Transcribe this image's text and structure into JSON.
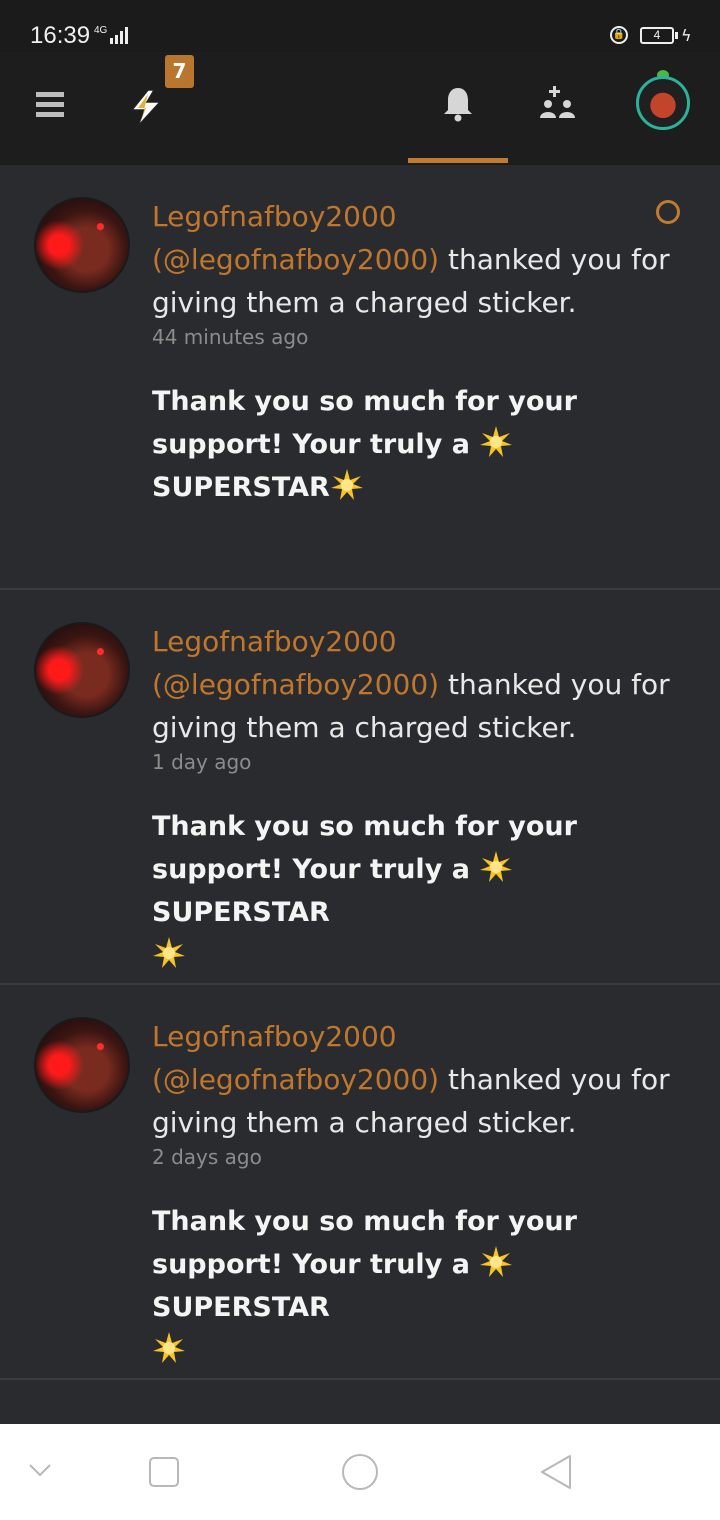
{
  "status": {
    "time": "16:39",
    "network": "4G",
    "battery": "4"
  },
  "header": {
    "badge_count": "7",
    "active_tab": "notifications"
  },
  "notifications": [
    {
      "user": "Legofnafboy2000",
      "handle": "(@legofnafboy2000)",
      "action": " thanked you for giving them a charged sticker.",
      "time": "44 minutes ago",
      "message_a": "Thank you so much for your support! Your truly a ",
      "message_b": "SUPERSTAR",
      "unread": true
    },
    {
      "user": "Legofnafboy2000",
      "handle": "(@legofnafboy2000)",
      "action": " thanked you for giving them a charged sticker.",
      "time": "1 day ago",
      "message_a": "Thank you so much for your support! Your truly a ",
      "message_b": "SUPERSTAR",
      "unread": false
    },
    {
      "user": "Legofnafboy2000",
      "handle": "(@legofnafboy2000)",
      "action": " thanked you for giving them a charged sticker.",
      "time": "2 days ago",
      "message_a": "Thank you so much for your support! Your truly a ",
      "message_b": "SUPERSTAR",
      "unread": false
    }
  ],
  "icons": {
    "menu": "hamburger-icon",
    "bolt": "lightning-icon",
    "bell": "bell-icon",
    "people": "add-person-icon",
    "star": "star-emoji"
  },
  "colors": {
    "accent": "#c07a32",
    "background": "#2a2b2e",
    "header": "#1d1d1e"
  }
}
